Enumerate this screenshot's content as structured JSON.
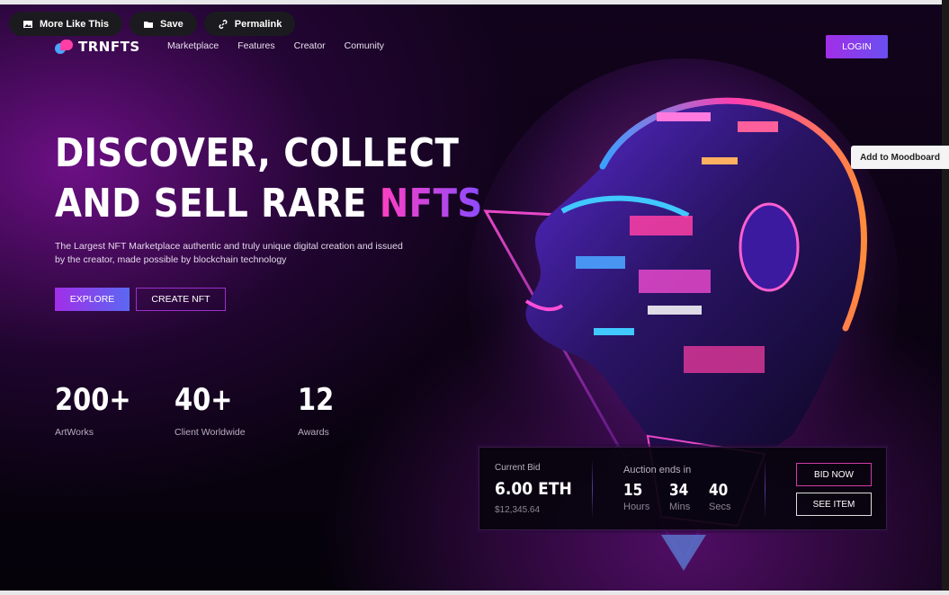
{
  "overlay": {
    "more_like_this": "More Like This",
    "save": "Save",
    "permalink": "Permalink",
    "add_to_moodboard": "Add to Moodboard"
  },
  "brand": {
    "name": "TRNFTS"
  },
  "nav": {
    "items": [
      "Marketplace",
      "Features",
      "Creator",
      "Comunity"
    ],
    "login": "LOGIN"
  },
  "hero": {
    "headline_line1": "DISCOVER, COLLECT",
    "headline_line2_prefix": "AND SELL RARE ",
    "headline_line2_accent": "NFTS",
    "subtext": "The Largest NFT Marketplace authentic and truly unique digital creation and issued by the creator, made possible by blockchain technology",
    "explore": "EXPLORE",
    "create_nft": "CREATE NFT"
  },
  "stats": [
    {
      "value": "200+",
      "label": "ArtWorks"
    },
    {
      "value": "40+",
      "label": "Client Worldwide"
    },
    {
      "value": "12",
      "label": "Awards"
    }
  ],
  "bid": {
    "label": "Current Bid",
    "value": "6.00 ETH",
    "usd": "$12,345.64",
    "auction_label": "Auction ends in",
    "timer": [
      {
        "value": "15",
        "unit": "Hours"
      },
      {
        "value": "34",
        "unit": "Mins"
      },
      {
        "value": "40",
        "unit": "Secs"
      }
    ],
    "bid_now": "BID NOW",
    "see_item": "SEE ITEM"
  },
  "colors": {
    "accent_pink": "#ff3fc2",
    "accent_purple": "#a12ee8",
    "accent_blue": "#5b68f2",
    "background": "#05020a"
  },
  "icons": [
    "image-icon",
    "folder-icon",
    "link-icon",
    "logo-icon"
  ]
}
